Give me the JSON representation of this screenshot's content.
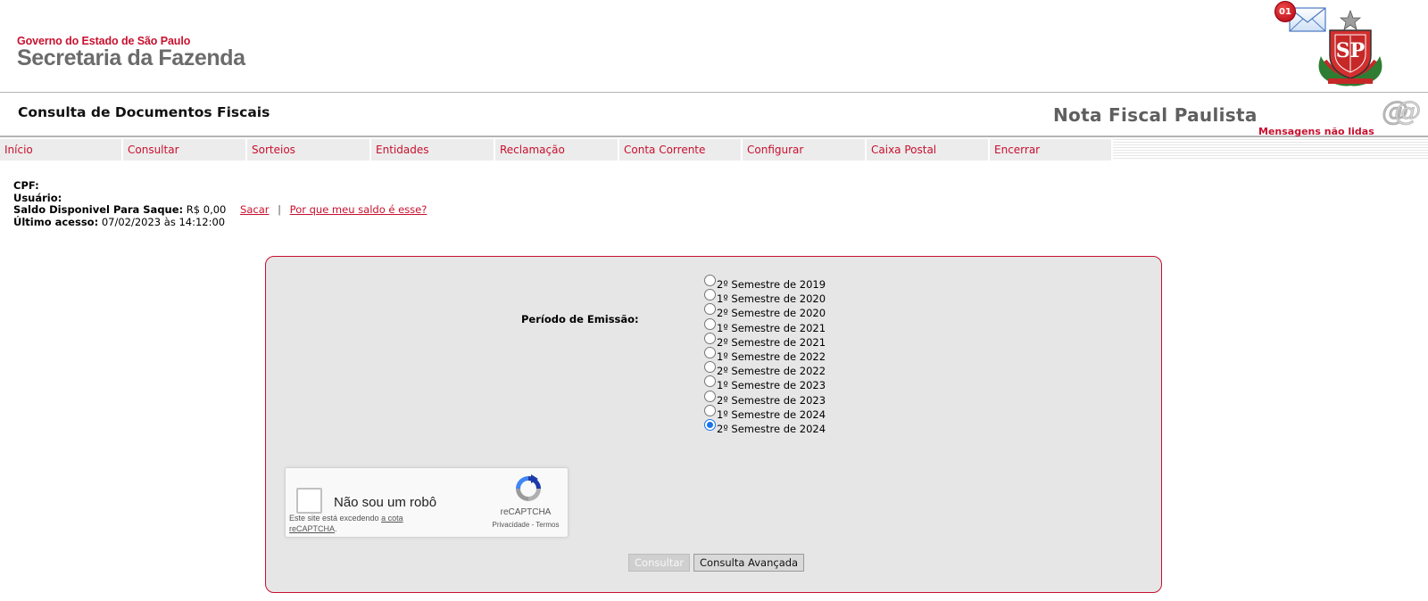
{
  "header": {
    "gov_line1": "Governo do Estado de São Paulo",
    "gov_line2": "Secretaria da Fazenda"
  },
  "subheader": {
    "page_title": "Consulta de Documentos Fiscais",
    "app_title": "Nota Fiscal Paulista",
    "messages_badge": "01",
    "messages_text": "Mensagens não lidas"
  },
  "nav": {
    "items": [
      "Início",
      "Consultar",
      "Sorteios",
      "Entidades",
      "Reclamação",
      "Conta Corrente",
      "Configurar",
      "Caixa Postal",
      "Encerrar"
    ]
  },
  "user": {
    "cpf_label": "CPF:",
    "usuario_label": "Usuário:",
    "saldo_label": "Saldo Disponivel Para Saque:",
    "saldo_value": "R$ 0,00",
    "sacar_link": "Sacar",
    "separator": "|",
    "por_que_link": "Por que meu saldo é esse?",
    "ultimo_label": "Último acesso:",
    "ultimo_value": "07/02/2023 às 14:12:00"
  },
  "form": {
    "periodo_label": "Período de Emissão:",
    "periods": [
      "2º Semestre de 2019",
      "1º Semestre de 2020",
      "2º Semestre de 2020",
      "1º Semestre de 2021",
      "2º Semestre de 2021",
      "1º Semestre de 2022",
      "2º Semestre de 2022",
      "1º Semestre de 2023",
      "2º Semestre de 2023",
      "1º Semestre de 2024",
      "2º Semestre de 2024"
    ],
    "selected_index": 10,
    "consultar_button": "Consultar",
    "avancada_button": "Consulta Avançada"
  },
  "recaptcha": {
    "label": "Não sou um robô",
    "warning_prefix": "Este site está excedendo",
    "warning_link": "a cota reCAPTCHA",
    "warning_suffix": ".",
    "brand": "reCAPTCHA",
    "privacy": "Privacidade",
    "terms_sep": "-",
    "terms": "Termos"
  },
  "colors": {
    "brand_red": "#c8102e",
    "panel_bg": "#e6e6e6",
    "nav_bg": "#ececec",
    "title_gray": "#5f5f5f"
  }
}
